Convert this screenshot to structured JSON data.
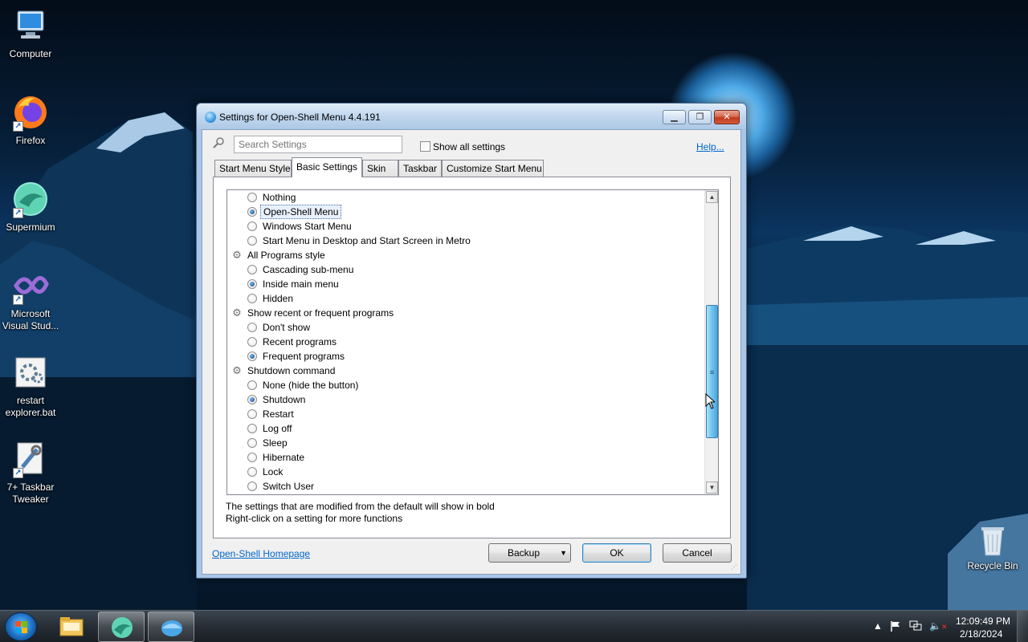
{
  "desktop": {
    "icons": [
      {
        "label": "Computer",
        "icon": "computer-icon"
      },
      {
        "label": "Firefox",
        "icon": "firefox-icon"
      },
      {
        "label": "Supermium",
        "icon": "supermium-icon"
      },
      {
        "label": "Microsoft Visual Stud...",
        "icon": "visual-studio-icon"
      },
      {
        "label": "restart explorer.bat",
        "icon": "batch-file-icon"
      },
      {
        "label": "7+ Taskbar Tweaker",
        "icon": "taskbar-tweaker-icon"
      },
      {
        "label": "Recycle Bin",
        "icon": "recycle-bin-icon"
      }
    ]
  },
  "window": {
    "title": "Settings for Open-Shell Menu 4.4.191",
    "search_placeholder": "Search Settings",
    "show_all_label": "Show all settings",
    "show_all_checked": false,
    "help_link": "Help...",
    "tabs": [
      {
        "label": "Start Menu Style",
        "active": false
      },
      {
        "label": "Basic Settings",
        "active": true
      },
      {
        "label": "Skin",
        "active": false
      },
      {
        "label": "Taskbar",
        "active": false
      },
      {
        "label": "Customize Start Menu",
        "active": false
      }
    ],
    "settings_rows": [
      {
        "type": "option",
        "label": "Nothing",
        "checked": false
      },
      {
        "type": "option",
        "label": "Open-Shell Menu",
        "checked": true,
        "selected": true
      },
      {
        "type": "option",
        "label": "Windows Start Menu",
        "checked": false
      },
      {
        "type": "option",
        "label": "Start Menu in Desktop and Start Screen in Metro",
        "checked": false
      },
      {
        "type": "group",
        "label": "All Programs style"
      },
      {
        "type": "option",
        "label": "Cascading sub-menu",
        "checked": false
      },
      {
        "type": "option",
        "label": "Inside main menu",
        "checked": true
      },
      {
        "type": "option",
        "label": "Hidden",
        "checked": false
      },
      {
        "type": "group",
        "label": "Show recent or frequent programs"
      },
      {
        "type": "option",
        "label": "Don't show",
        "checked": false
      },
      {
        "type": "option",
        "label": "Recent programs",
        "checked": false
      },
      {
        "type": "option",
        "label": "Frequent programs",
        "checked": true
      },
      {
        "type": "group",
        "label": "Shutdown command"
      },
      {
        "type": "option",
        "label": "None (hide the button)",
        "checked": false
      },
      {
        "type": "option",
        "label": "Shutdown",
        "checked": true
      },
      {
        "type": "option",
        "label": "Restart",
        "checked": false
      },
      {
        "type": "option",
        "label": "Log off",
        "checked": false
      },
      {
        "type": "option",
        "label": "Sleep",
        "checked": false
      },
      {
        "type": "option",
        "label": "Hibernate",
        "checked": false
      },
      {
        "type": "option",
        "label": "Lock",
        "checked": false
      },
      {
        "type": "option",
        "label": "Switch User",
        "checked": false
      }
    ],
    "info_line1": "The settings that are modified from the default will show in bold",
    "info_line2": "Right-click on a setting for more functions",
    "homepage_link": "Open-Shell Homepage",
    "backup_label": "Backup",
    "ok_label": "OK",
    "cancel_label": "Cancel"
  },
  "taskbar": {
    "pinned": [
      {
        "name": "file-explorer",
        "running": false
      },
      {
        "name": "supermium",
        "running": true
      },
      {
        "name": "open-shell-settings",
        "running": true
      }
    ],
    "clock_time": "12:09:49 PM",
    "clock_date": "2/18/2024"
  },
  "colors": {
    "accent": "#3c7fb1",
    "link": "#0066cc",
    "title_bar": "#c3d8ef"
  }
}
